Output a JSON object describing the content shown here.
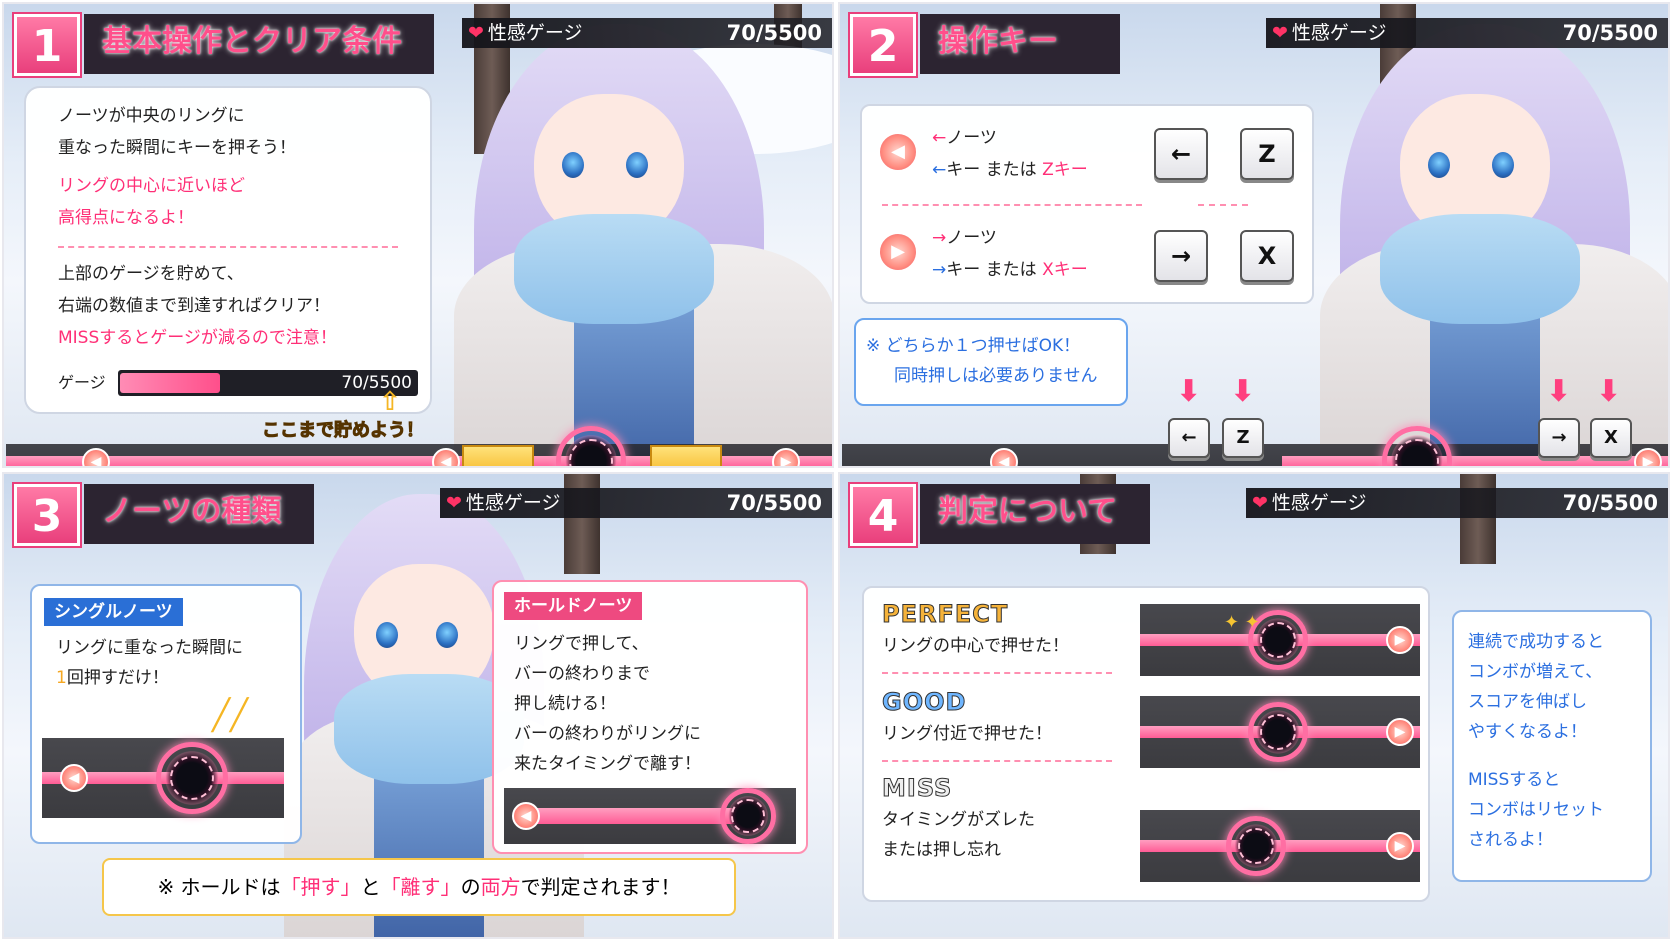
{
  "panel1": {
    "number": "1",
    "title": "基本操作とクリア条件",
    "gauge": {
      "label": "性感ゲージ",
      "value": "70/5500"
    },
    "lines": [
      "ノーツが中央のリングに",
      "重なった瞬間にキーを押そう！"
    ],
    "pink_lines": [
      "リングの中心に近いほど",
      "高得点になるよ！"
    ],
    "lines2": [
      "上部のゲージを貯めて、",
      "右端の数値まで到達すればクリア！"
    ],
    "pink_line2": "MISSするとゲージが減るので注意！",
    "mini_gauge_label": "ゲージ",
    "mini_gauge_value": "70/5500",
    "pointer_text": "ここまで貯めよう！"
  },
  "panel2": {
    "number": "2",
    "title": "操作キー",
    "gauge": {
      "label": "性感ゲージ",
      "value": "70/5500"
    },
    "left_note_label": "ノーツ",
    "left_key_line_a": "キー または ",
    "left_key_line_b": "Zキー",
    "right_note_label": "ノーツ",
    "right_key_line_a": "キー または ",
    "right_key_line_b": "Xキー",
    "key_left": "←",
    "key_z": "Z",
    "key_right": "→",
    "key_x": "X",
    "note_lines": [
      "※ どちらか１つ押せばOK！",
      "同時押しは必要ありません"
    ]
  },
  "panel3": {
    "number": "3",
    "title": "ノーツの種類",
    "gauge": {
      "label": "性感ゲージ",
      "value": "70/5500"
    },
    "single_label": "シングルノーツ",
    "single_line1": "リングに重なった瞬間に",
    "single_line2_num": "1",
    "single_line2_rest": "回押すだけ！",
    "hold_label": "ホールドノーツ",
    "hold_lines": [
      "リングで押して、",
      "バーの終わりまで",
      "押し続ける！",
      "バーの終わりがリングに",
      "来たタイミングで離す！"
    ],
    "footer": {
      "prefix": "※ ホールドは",
      "push": "「押す」",
      "and": "と",
      "release": "「離す」",
      "no": "の",
      "both": "両方",
      "suffix": "で判定されます！"
    }
  },
  "panel4": {
    "number": "4",
    "title": "判定について",
    "gauge": {
      "label": "性感ゲージ",
      "value": "70/5500"
    },
    "perfect": "PERFECT",
    "perfect_desc": "リングの中心で押せた！",
    "good": "GOOD",
    "good_desc": "リング付近で押せた！",
    "miss": "MISS",
    "miss_desc_1": "タイミングがズレた",
    "miss_desc_2": "または押し忘れ",
    "combo_lines": [
      "連続で成功すると",
      "コンボが増えて、",
      "スコアを伸ばし",
      "やすくなるよ！"
    ],
    "combo_lines2": [
      "MISSすると",
      "コンボはリセット",
      "されるよ！"
    ]
  },
  "colors": {
    "accent": "#ff2f77",
    "blue": "#2b6fe0",
    "perfect": "#f5b33a",
    "good": "#6fb6ff",
    "miss": "#e6e6e6"
  }
}
